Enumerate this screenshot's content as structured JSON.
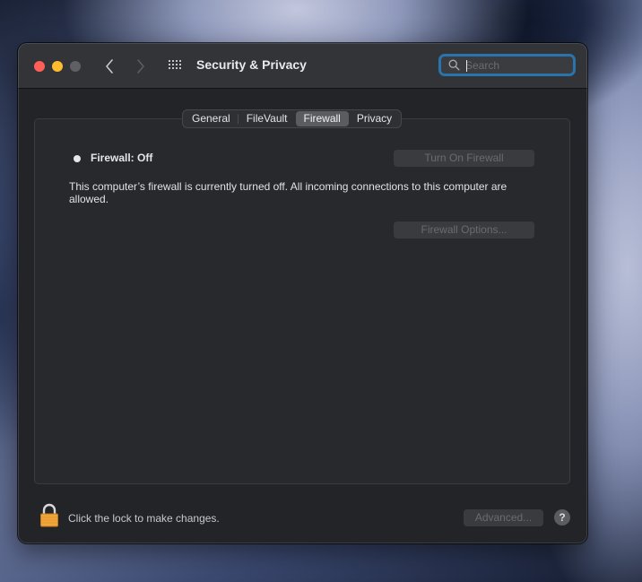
{
  "window": {
    "title": "Security & Privacy",
    "traffic_lights": {
      "close_color": "#ff5f57",
      "minimize_color": "#febc2e",
      "zoom_color": "#5f6063"
    }
  },
  "toolbar": {
    "back_icon": "chevron-left-icon",
    "forward_icon": "chevron-right-icon",
    "show_all_icon": "grid-icon",
    "search": {
      "placeholder": "Search",
      "value": "",
      "icon": "magnifying-glass-icon",
      "focus_color": "#2a74ad"
    }
  },
  "tabs": [
    {
      "label": "General",
      "active": false
    },
    {
      "label": "FileVault",
      "active": false
    },
    {
      "label": "Firewall",
      "active": true
    },
    {
      "label": "Privacy",
      "active": false
    }
  ],
  "firewall": {
    "status_label": "Firewall: Off",
    "status_icon": "status-dot-icon",
    "turn_on_button": "Turn On Firewall",
    "description": "This computer’s firewall is currently turned off. All incoming connections to this computer are allowed.",
    "options_button": "Firewall Options..."
  },
  "footer": {
    "lock_icon": "lock-icon",
    "lock_text": "Click the lock to make changes.",
    "advanced_button": "Advanced...",
    "help_button": "?"
  }
}
